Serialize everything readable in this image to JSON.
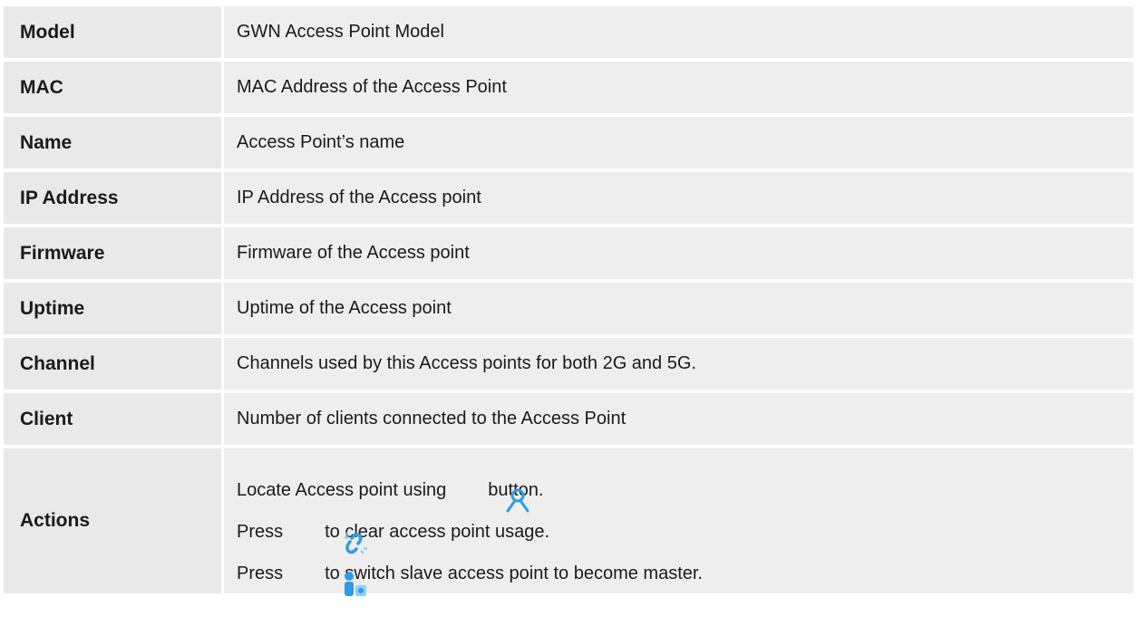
{
  "rows": [
    {
      "key": "Model",
      "value": "GWN Access Point Model"
    },
    {
      "key": "MAC",
      "value": "MAC Address of the Access Point"
    },
    {
      "key": "Name",
      "value": "Access Point’s name"
    },
    {
      "key": "IP Address",
      "value": "IP Address of the Access point"
    },
    {
      "key": "Firmware",
      "value": "Firmware of the Access point"
    },
    {
      "key": "Uptime",
      "value": "Uptime of the Access point"
    },
    {
      "key": "Channel",
      "value": "Channels used by this Access points for both 2G and 5G."
    },
    {
      "key": "Client",
      "value": "Number of clients connected to the Access Point"
    }
  ],
  "actions": {
    "key": "Actions",
    "locate": {
      "before": "Locate Access point using",
      "after": "button.",
      "icon": "locate-icon"
    },
    "clear": {
      "before": "Press",
      "after": "to clear access point usage.",
      "icon": "unlink-icon"
    },
    "master": {
      "before": "Press",
      "after": "to switch slave access point to become master.",
      "icon": "switch-master-icon"
    }
  },
  "colors": {
    "key_bg": "#e9e9e9",
    "value_bg": "#eeeeee",
    "icon_blue": "#2f9be6"
  }
}
